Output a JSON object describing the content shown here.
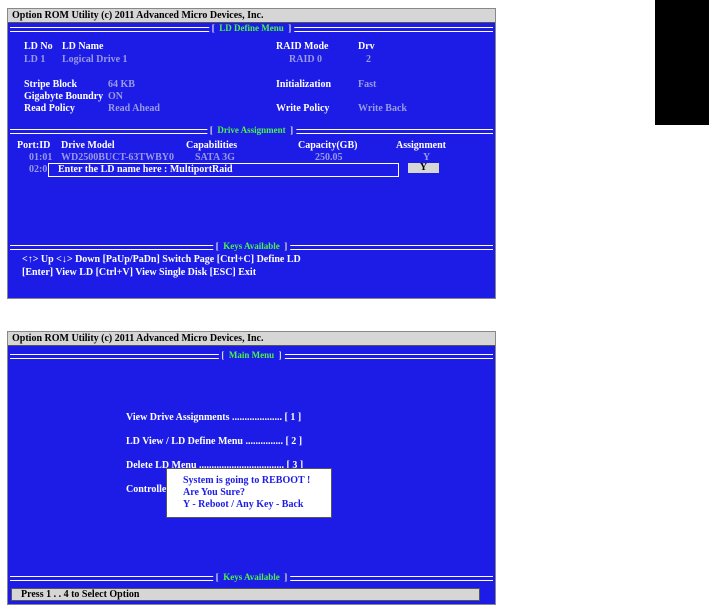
{
  "top": {
    "title": "Option  ROM  Utility  (c)  2011  Advanced Micro Devices, Inc.",
    "ld_define_menu": {
      "bracket_open": "[",
      "name": "LD Define Menu",
      "bracket_close": "]"
    },
    "ld_no_label": "LD No",
    "ld_name_label": "LD Name",
    "raid_mode_label": "RAID Mode",
    "drv_label": "Drv",
    "ld_no_value": "LD  1",
    "ld_name_value": "Logical Drive 1",
    "raid_mode_value": "RAID 0",
    "drv_value": "2",
    "stripe_block_label": "Stripe Block",
    "stripe_block_value": "64   KB",
    "initialization_label": "Initialization",
    "initialization_value": "Fast",
    "gigabyte_boundry_label": "Gigabyte Boundry",
    "gigabyte_boundry_value": "ON",
    "read_policy_label": "Read Policy",
    "read_policy_value": "Read Ahead",
    "write_policy_label": "Write Policy",
    "write_policy_value": "Write Back",
    "drive_assignment": {
      "bracket_open": "[",
      "name": "Drive Assignment",
      "bracket_close": "]"
    },
    "table_headers": {
      "port": "Port:ID",
      "model": "Drive Model",
      "capabilities": "Capabilities",
      "capacity": "Capacity(GB)",
      "assignment": "Assignment"
    },
    "row1": {
      "port": "01:01",
      "model": "WD2500BUCT-63TWBY0",
      "capabilities": "SATA  3G",
      "capacity": "250.05",
      "assignment": "Y"
    },
    "row2": {
      "port": "02:0",
      "assignment": "Y"
    },
    "input_prompt": "Enter the LD name here :  MultiportRaid",
    "keys_available": {
      "bracket_open": "[",
      "name": "Keys Available",
      "bracket_close": "]"
    },
    "keys_line1": "<↑> Up     <↓> Down     [PaUp/PaDn] Switch Page     [Ctrl+C]  Define LD",
    "keys_line2": "[Enter]  View LD       [Ctrl+V] View Single Disk        [ESC] Exit"
  },
  "bottom": {
    "title": "Option  ROM  Utility  (c)  2011  Advanced Micro Devices, Inc.",
    "main_menu": {
      "bracket_open": "[",
      "name": "Main Menu",
      "bracket_close": "]"
    },
    "menu_items": [
      "View  Drive  Assignments .................... [ 1 ]",
      "LD View  /  LD Define Menu ............... [ 2 ]",
      "Delete  LD  Menu .................................. [ 3 ]",
      "Controlle"
    ],
    "reboot_dialog": {
      "line1": "System is going to REBOOT !",
      "line2": "Are You Sure?",
      "line3": "Y - Reboot  /  Any Key - Back"
    },
    "keys_available": {
      "bracket_open": "[",
      "name": "Keys Available",
      "bracket_close": "]"
    },
    "status": "Press  1 . . 4  to  Select  Option"
  },
  "colors": {
    "screen_blue": "#1c1ce6",
    "title_gray": "#d6d6d6",
    "section_green": "#4cf24c",
    "label_yellow": "#ffff99"
  }
}
